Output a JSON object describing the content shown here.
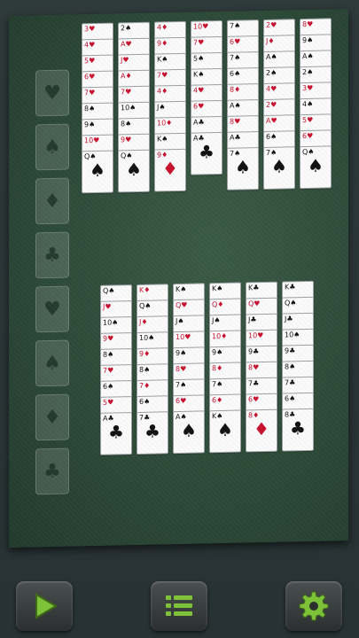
{
  "foundations": [
    {
      "suit": "♥",
      "red": true
    },
    {
      "suit": "♠",
      "red": false
    },
    {
      "suit": "♦",
      "red": true
    },
    {
      "suit": "♣",
      "red": false
    },
    {
      "suit": "♥",
      "red": true
    },
    {
      "suit": "♠",
      "red": false
    },
    {
      "suit": "♦",
      "red": true
    },
    {
      "suit": "♣",
      "red": false
    }
  ],
  "top_columns": [
    [
      "3♥",
      "4♥",
      "5♥",
      "6♥",
      "7♥",
      "8♠",
      "9♠",
      "10♥",
      "Q♠"
    ],
    [
      "2♠",
      "A♥",
      "J♥",
      "A♦",
      "7♥",
      "10♠",
      "8♠",
      "9♥",
      "Q♠"
    ],
    [
      "4♦",
      "9♦",
      "K♠",
      "7♥",
      "4♦",
      "J♠",
      "10♦",
      "K♠",
      "9♦"
    ],
    [
      "10♥",
      "7♥",
      "5♠",
      "K♠",
      "4♥",
      "6♥",
      "A♣",
      "A♣"
    ],
    [
      "7♠",
      "6♥",
      "7♠",
      "6♠",
      "8♦",
      "A♠",
      "8♥",
      "A♣",
      "7♠"
    ],
    [
      "2♥",
      "J♦",
      "A♠",
      "2♠",
      "4♥",
      "2♥",
      "A♥",
      "6♠",
      "7♠"
    ],
    [
      "8♥",
      "9♠",
      "A♠",
      "2♠",
      "3♥",
      "4♠",
      "5♥",
      "6♥",
      "Q♠"
    ]
  ],
  "bottom_columns": [
    [
      "Q♠",
      "J♥",
      "10♠",
      "9♥",
      "8♠",
      "7♥",
      "6♠",
      "5♥",
      "A♣"
    ],
    [
      "K♦",
      "Q♠",
      "J♦",
      "10♠",
      "9♦",
      "8♠",
      "7♦",
      "6♠",
      "7♣"
    ],
    [
      "K♠",
      "Q♥",
      "J♠",
      "10♥",
      "9♠",
      "8♥",
      "7♠",
      "6♥",
      "A♠"
    ],
    [
      "K♠",
      "Q♦",
      "J♠",
      "10♦",
      "9♠",
      "8♦",
      "7♠",
      "6♦",
      "K♠"
    ],
    [
      "K♣",
      "Q♥",
      "J♣",
      "10♥",
      "9♣",
      "8♥",
      "7♣",
      "6♥",
      "8♦"
    ],
    [
      "K♣",
      "Q♠",
      "J♣",
      "10♠",
      "9♣",
      "8♠",
      "7♣",
      "6♠",
      "8♣"
    ]
  ],
  "buttons": {
    "play": "play-icon",
    "menu": "menu-icon",
    "settings": "gear-icon"
  },
  "colors": {
    "felt": "#2d4a38",
    "accent": "#7ec23a",
    "red_suit": "#c8102e"
  }
}
